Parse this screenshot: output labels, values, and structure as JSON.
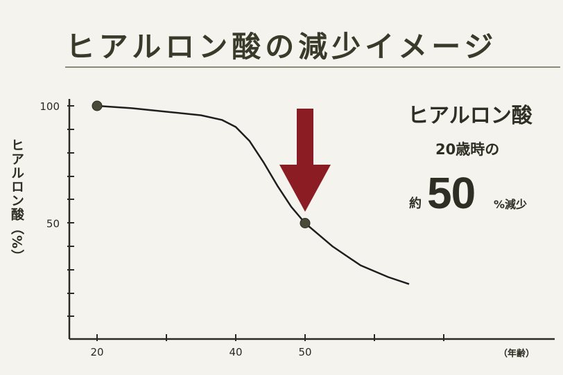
{
  "chart_data": {
    "type": "line",
    "title": "ヒアルロン酸の減少イメージ",
    "ylabel": "ヒアルロン酸（%）",
    "xunit": "（年齢）",
    "xticks": [
      "20",
      "40",
      "50"
    ],
    "yticks": [
      "100",
      "50"
    ],
    "xlim": [
      19.5,
      66
    ],
    "ylim": [
      0,
      100
    ],
    "series": [
      {
        "x": [
          20,
          25,
          30,
          35,
          38,
          40,
          42,
          44,
          46,
          48,
          50,
          52,
          54,
          56,
          58,
          62,
          65
        ],
        "y": [
          100,
          99,
          97.5,
          96,
          94,
          91,
          85,
          76,
          66,
          57,
          50,
          45,
          40,
          36,
          32,
          27,
          24
        ]
      }
    ],
    "markers": [
      {
        "x": 20,
        "y": 100
      },
      {
        "x": 50,
        "y": 50
      }
    ],
    "annotation": {
      "title": "ヒアルロン酸",
      "subtitle": "20歳時の",
      "prefix": "約",
      "value": "50",
      "suffix": "%減少"
    },
    "arrow_color": "#8b1c24",
    "line_color": "#1e1e1e",
    "marker_color": "#4a4a38",
    "grid": false
  }
}
